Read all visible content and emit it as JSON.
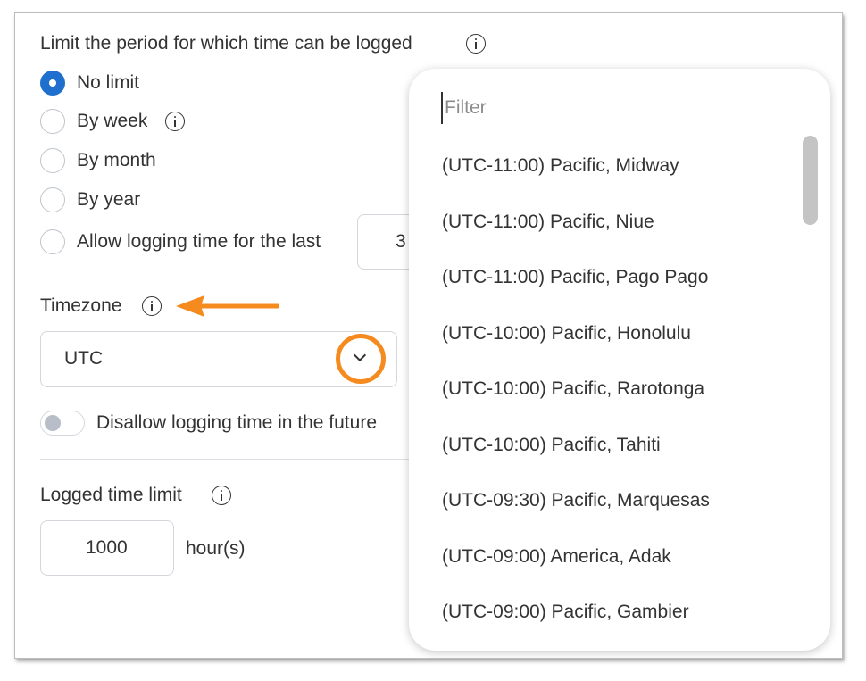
{
  "period": {
    "heading": "Limit the period for which time can be logged",
    "options": [
      {
        "label": "No limit",
        "checked": true
      },
      {
        "label": "By week",
        "checked": false
      },
      {
        "label": "By month",
        "checked": false
      },
      {
        "label": "By year",
        "checked": false
      },
      {
        "label": "Allow logging time for the last",
        "checked": false
      }
    ],
    "last_value": "3"
  },
  "timezone": {
    "label": "Timezone",
    "selected": "UTC"
  },
  "future": {
    "label": "Disallow logging time in the future"
  },
  "limit": {
    "label": "Logged time limit",
    "value": "1000",
    "unit": "hour(s)"
  },
  "dropdown": {
    "filter_placeholder": "Filter",
    "items": [
      "(UTC-11:00) Pacific, Midway",
      "(UTC-11:00) Pacific, Niue",
      "(UTC-11:00) Pacific, Pago Pago",
      "(UTC-10:00) Pacific, Honolulu",
      "(UTC-10:00) Pacific, Rarotonga",
      "(UTC-10:00) Pacific, Tahiti",
      "(UTC-09:30) Pacific, Marquesas",
      "(UTC-09:00) America, Adak",
      "(UTC-09:00) Pacific, Gambier"
    ]
  },
  "colors": {
    "accent": "#1f6fce",
    "annotation": "#f58b1f"
  }
}
